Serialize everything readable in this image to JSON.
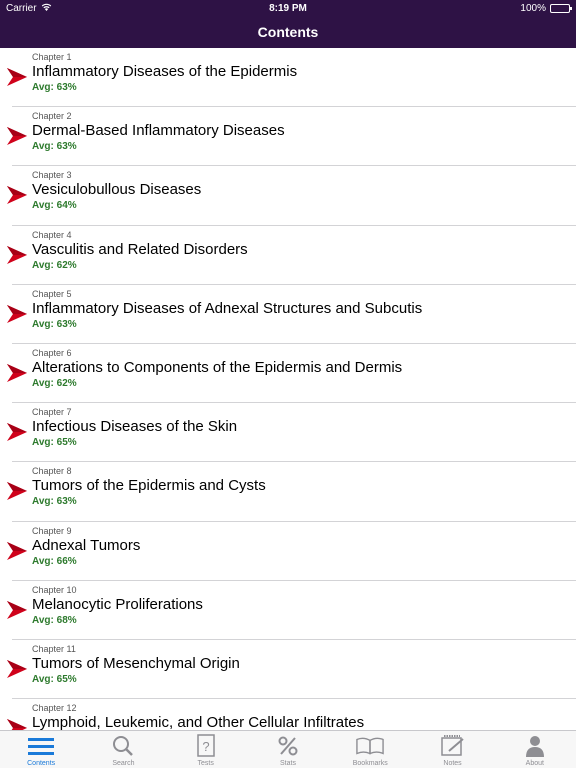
{
  "status": {
    "carrier": "Carrier",
    "time": "8:19 PM",
    "battery": "100%",
    "battery_level": 1.0
  },
  "nav": {
    "title": "Contents"
  },
  "chapters": [
    {
      "label": "Chapter 1",
      "title": "Inflammatory Diseases of the Epidermis",
      "avg": "Avg: 63%"
    },
    {
      "label": "Chapter 2",
      "title": "Dermal-Based Inflammatory Diseases",
      "avg": "Avg: 63%"
    },
    {
      "label": "Chapter 3",
      "title": "Vesiculobullous Diseases",
      "avg": "Avg: 64%"
    },
    {
      "label": "Chapter 4",
      "title": "Vasculitis and Related Disorders",
      "avg": "Avg: 62%"
    },
    {
      "label": "Chapter 5",
      "title": "Inflammatory Diseases of Adnexal Structures and Subcutis",
      "avg": "Avg: 63%"
    },
    {
      "label": "Chapter 6",
      "title": "Alterations to Components of the Epidermis and Dermis",
      "avg": "Avg: 62%"
    },
    {
      "label": "Chapter 7",
      "title": "Infectious Diseases of the Skin",
      "avg": "Avg: 65%"
    },
    {
      "label": "Chapter 8",
      "title": "Tumors of the Epidermis and Cysts",
      "avg": "Avg: 63%"
    },
    {
      "label": "Chapter 9",
      "title": "Adnexal Tumors",
      "avg": "Avg: 66%"
    },
    {
      "label": "Chapter 10",
      "title": "Melanocytic Proliferations",
      "avg": "Avg: 68%"
    },
    {
      "label": "Chapter 11",
      "title": "Tumors of Mesenchymal Origin",
      "avg": "Avg: 65%"
    },
    {
      "label": "Chapter 12",
      "title": "Lymphoid, Leukemic, and Other Cellular Infiltrates",
      "avg": ""
    }
  ],
  "tabs": [
    {
      "label": "Contents",
      "icon": "list-icon",
      "active": true
    },
    {
      "label": "Search",
      "icon": "magnifier-icon",
      "active": false
    },
    {
      "label": "Tests",
      "icon": "question-page-icon",
      "active": false
    },
    {
      "label": "Stats",
      "icon": "percent-icon",
      "active": false
    },
    {
      "label": "Bookmarks",
      "icon": "open-book-icon",
      "active": false
    },
    {
      "label": "Notes",
      "icon": "notepad-icon",
      "active": false
    },
    {
      "label": "About",
      "icon": "person-icon",
      "active": false
    }
  ],
  "colors": {
    "header": "#2e1245",
    "arrow": "#d0021b",
    "avg": "#2d7a2d",
    "active_tab": "#1a7ad9",
    "inactive_tab": "#8e8e93"
  }
}
